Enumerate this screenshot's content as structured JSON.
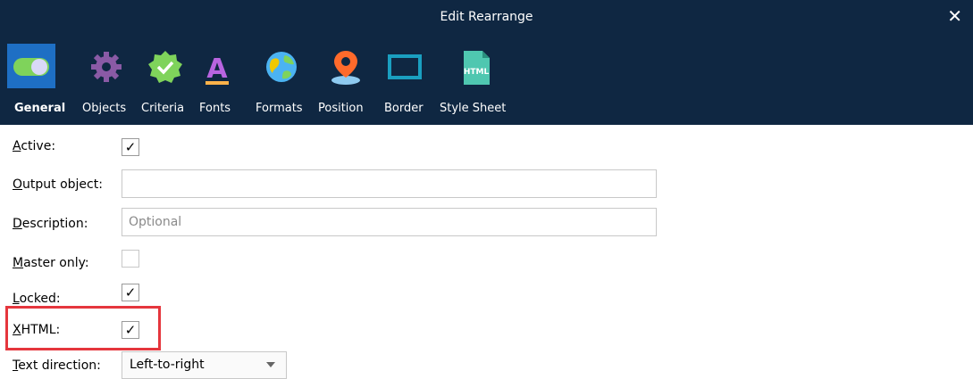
{
  "window": {
    "title": "Edit Rearrange",
    "close_glyph": "✕"
  },
  "toolbar": {
    "items": [
      {
        "label": "General",
        "icon": "toggle-icon",
        "selected": true
      },
      {
        "label": "Objects",
        "icon": "gear-icon"
      },
      {
        "label": "Criteria",
        "icon": "badge-check-icon"
      },
      {
        "label": "Fonts",
        "icon": "font-a-icon"
      },
      {
        "label": "Formats",
        "icon": "globe-icon"
      },
      {
        "label": "Position",
        "icon": "map-pin-icon"
      },
      {
        "label": "Border",
        "icon": "border-box-icon"
      },
      {
        "label": "Style Sheet",
        "icon": "html-file-icon"
      }
    ]
  },
  "form": {
    "active": {
      "label_key": "A",
      "label_rest": "ctive:",
      "checked": true
    },
    "output_object": {
      "label_key": "O",
      "label_rest": "utput object:",
      "value": ""
    },
    "description": {
      "label_key": "D",
      "label_rest": "escription:",
      "value": "",
      "placeholder": "Optional"
    },
    "master_only": {
      "label_key": "M",
      "label_rest": "aster only:",
      "checked": false
    },
    "locked": {
      "label_key": "L",
      "label_rest": "ocked:",
      "checked": true
    },
    "xhtml": {
      "label_key": "X",
      "label_rest": "HTML:",
      "checked": true
    },
    "text_direction": {
      "label_key": "T",
      "label_rest": "ext direction:",
      "value": "Left-to-right"
    }
  },
  "check_glyph": "✓",
  "colors": {
    "titlebar": "#0f2742",
    "selected_tab": "#1e6fc4",
    "highlight": "#e5363d"
  }
}
